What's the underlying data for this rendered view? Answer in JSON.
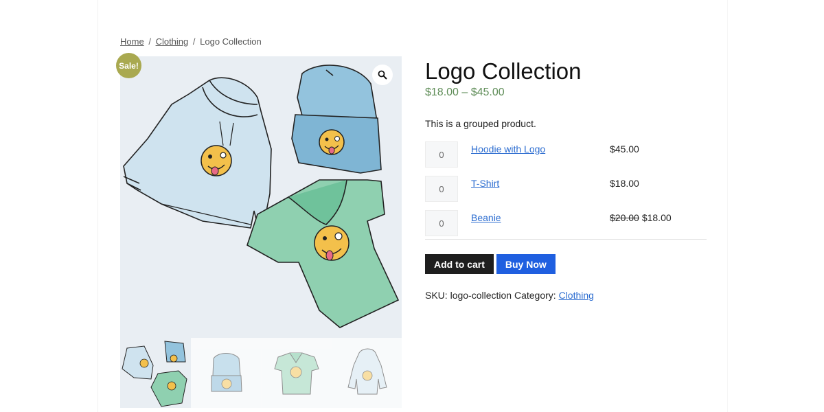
{
  "breadcrumb": {
    "home": "Home",
    "separator": "/",
    "category": "Clothing",
    "current": "Logo Collection"
  },
  "badge": {
    "sale": "Sale!"
  },
  "gallery": {
    "zoom_icon": "magnifier-icon",
    "thumbnails": [
      "logo-collection",
      "beanie",
      "t-shirt",
      "hoodie"
    ]
  },
  "product": {
    "title": "Logo Collection",
    "price_range": "$18.00 – $45.00",
    "short_description": "This is a grouped product."
  },
  "grouped_items": [
    {
      "qty": "0",
      "name": "Hoodie with Logo",
      "old_price": "",
      "price": "$45.00"
    },
    {
      "qty": "0",
      "name": "T-Shirt",
      "old_price": "",
      "price": "$18.00"
    },
    {
      "qty": "0",
      "name": "Beanie",
      "old_price": "$20.00",
      "price": "$18.00"
    }
  ],
  "actions": {
    "add_to_cart": "Add to cart",
    "buy_now": "Buy Now"
  },
  "meta": {
    "sku_label": "SKU:",
    "sku_value": "logo-collection",
    "category_label": "Category:",
    "category_value": "Clothing"
  },
  "colors": {
    "sale_badge": "#a9a950",
    "price_green": "#5f8d58",
    "link_blue": "#2b6cd0",
    "cart_button": "#1e1e1e",
    "buy_button": "#1f5fe0"
  }
}
